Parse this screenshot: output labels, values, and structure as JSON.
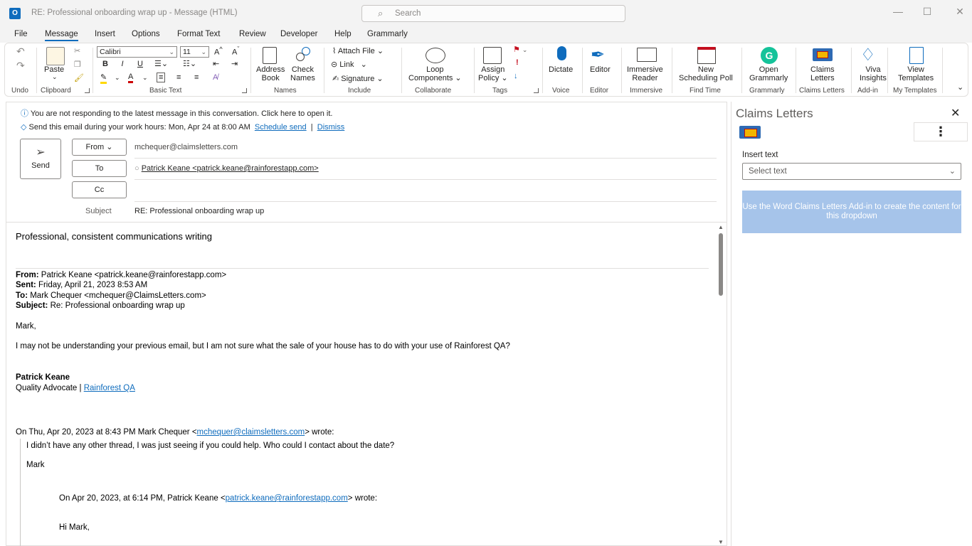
{
  "window": {
    "title": "RE: Professional onboarding wrap up  -  Message (HTML)",
    "search_placeholder": "Search"
  },
  "menu": [
    "File",
    "Message",
    "Insert",
    "Options",
    "Format Text",
    "Review",
    "Developer",
    "Help",
    "Grammarly"
  ],
  "menu_active": "Message",
  "ribbon": {
    "groups": {
      "undo": "Undo",
      "clipboard": "Clipboard",
      "basic_text": "Basic Text",
      "names": "Names",
      "include": "Include",
      "collaborate": "Collaborate",
      "tags": "Tags",
      "voice": "Voice",
      "editor": "Editor",
      "immersive": "Immersive",
      "find_time": "Find Time",
      "grammarly": "Grammarly",
      "claims_letters": "Claims Letters",
      "add_in": "Add-in",
      "my_templates": "My Templates"
    },
    "paste": "Paste",
    "font_name": "Calibri",
    "font_size": "11",
    "bold": "B",
    "italic": "I",
    "underline": "U",
    "address_book": [
      "Address",
      "Book"
    ],
    "check_names": [
      "Check",
      "Names"
    ],
    "attach_file": "Attach File",
    "link": "Link",
    "signature": "Signature",
    "loop_components": [
      "Loop",
      "Components"
    ],
    "assign_policy": [
      "Assign",
      "Policy"
    ],
    "dictate": "Dictate",
    "editor": "Editor",
    "immersive_reader": [
      "Immersive",
      "Reader"
    ],
    "new_scheduling_poll": [
      "New",
      "Scheduling Poll"
    ],
    "open_grammarly": [
      "Open",
      "Grammarly"
    ],
    "claims_letters": [
      "Claims",
      "Letters"
    ],
    "viva_insights": [
      "Viva",
      "Insights"
    ],
    "view_templates": [
      "View",
      "Templates"
    ]
  },
  "compose": {
    "info1": "You are not responding to the latest message in this conversation. Click here to open it.",
    "info2_text": "Send this email during your work hours: Mon, Apr 24 at 8:00 AM",
    "schedule_send": "Schedule send",
    "separator": "|",
    "dismiss": "Dismiss",
    "send": "Send",
    "from_btn": "From",
    "from_value": "mchequer@claimsletters.com",
    "to_btn": "To",
    "to_value": "Patrick Keane <patrick.keane@rainforestapp.com>",
    "cc_btn": "Cc",
    "subject_label": "Subject",
    "subject_value": "RE: Professional onboarding wrap up"
  },
  "body": {
    "intro": "Professional, consistent communications writing",
    "hdr_from_label": "From:",
    "hdr_from": " Patrick Keane <patrick.keane@rainforestapp.com>",
    "hdr_sent_label": "Sent:",
    "hdr_sent": " Friday, April 21, 2023 8:53 AM",
    "hdr_to_label": "To:",
    "hdr_to": " Mark Chequer <mchequer@ClaimsLetters.com>",
    "hdr_subject_label": "Subject:",
    "hdr_subject": " Re: Professional onboarding wrap up",
    "greeting": "Mark,",
    "para1": "I may not be understanding your previous email, but I am not sure what the sale of your house has to do with your use of Rainforest QA?",
    "sig_name": "Patrick Keane",
    "sig_title": "Quality Advocate | ",
    "sig_company": "Rainforest QA",
    "wrote1_pre": "On Thu, Apr 20, 2023 at 8:43 PM Mark Chequer <",
    "wrote1_email": "mchequer@claimsletters.com",
    "wrote1_post": "> wrote:",
    "quote1": "I didn’t have any other thread, I was just seeing if you could help. Who could I contact about the date?",
    "quote1_sig": "Mark",
    "wrote2_pre": "On Apr 20, 2023, at 6:14 PM, Patrick Keane <",
    "wrote2_email": "patrick.keane@rainforestapp.com",
    "wrote2_post": "> wrote:",
    "quote2_greeting": "Hi Mark,"
  },
  "side_panel": {
    "title": "Claims Letters",
    "more": "⋮",
    "insert_label": "Insert text",
    "select_placeholder": "Select text",
    "notice": "Use the Word Claims Letters Add-in to create the content for this dropdown"
  }
}
